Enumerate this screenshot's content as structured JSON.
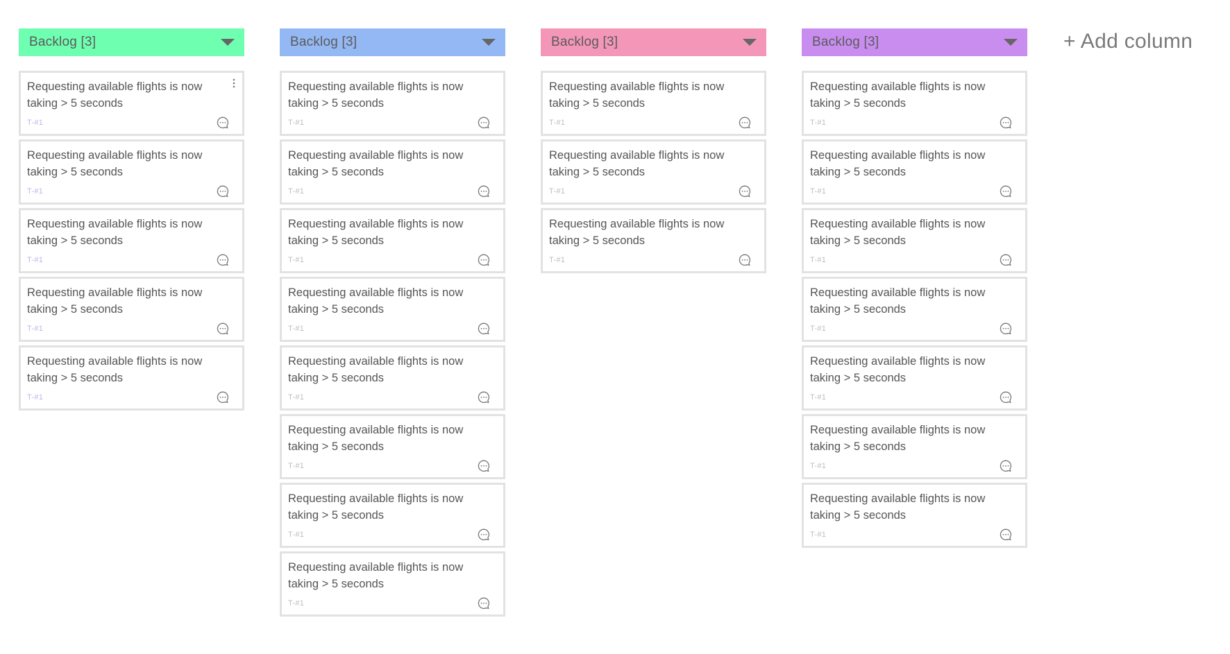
{
  "add_column_label": "+ Add column",
  "card_text": "Requesting available flights is now taking > 5 seconds",
  "card_id": "T-#1",
  "columns": [
    {
      "title": "Backlog [3]",
      "color": "#6fffb1",
      "card_count": 5
    },
    {
      "title": "Backlog [3]",
      "color": "#94b8f4",
      "card_count": 8
    },
    {
      "title": "Backlog [3]",
      "color": "#f396b8",
      "card_count": 3
    },
    {
      "title": "Backlog [3]",
      "color": "#c98df0",
      "card_count": 7
    }
  ],
  "icons": {
    "dropdown": "chevron-down-icon",
    "comment": "comment-bubble-icon",
    "more": "more-vertical-icon"
  }
}
